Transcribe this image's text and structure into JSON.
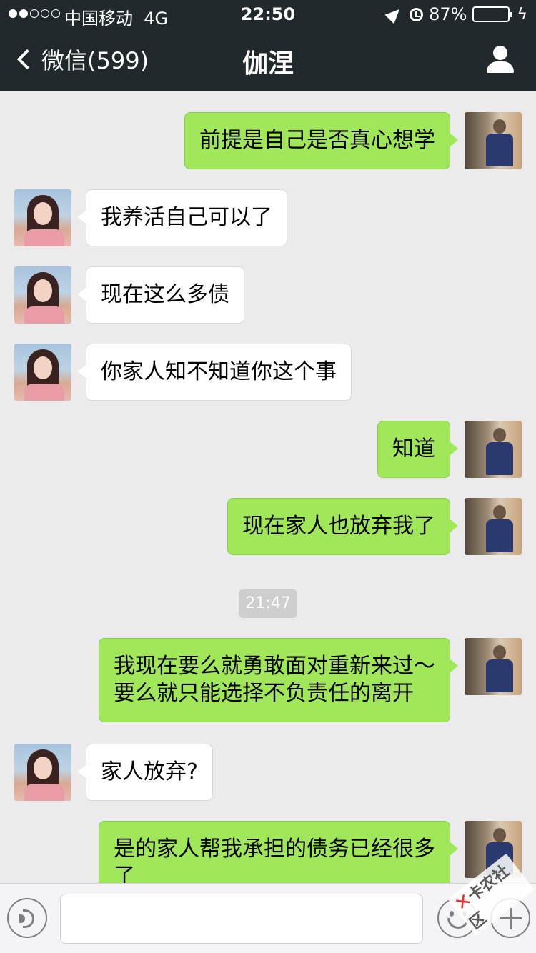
{
  "status_bar": {
    "carrier": "中国移动",
    "network": "4G",
    "time": "22:50",
    "battery_percent": "87%",
    "battery_level": 0.87,
    "signal_bars_filled": 2,
    "signal_bars_total": 5
  },
  "nav": {
    "back_label": "微信(599)",
    "title": "伽涅"
  },
  "messages": [
    {
      "side": "out",
      "text": "前提是自己是否真心想学"
    },
    {
      "side": "in",
      "text": "我养活自己可以了"
    },
    {
      "side": "in",
      "text": "现在这么多债"
    },
    {
      "side": "in",
      "text": "你家人知不知道你这个事"
    },
    {
      "side": "out",
      "text": "知道"
    },
    {
      "side": "out",
      "text": "现在家人也放弃我了"
    },
    {
      "timestamp": "21:47"
    },
    {
      "side": "out",
      "lines": [
        "我现在要么就勇敢面对重新来过～",
        "要么就只能选择不负责任的离开"
      ]
    },
    {
      "side": "in",
      "text": "家人放弃?"
    },
    {
      "side": "out",
      "lines": [
        "是的家人帮我承担的债务已经很多",
        "了"
      ]
    }
  ],
  "watermark": "卡农社区",
  "colors": {
    "nav_bg": "#22292c",
    "chat_bg": "#ebebeb",
    "outgoing_bubble": "#a0e75a",
    "incoming_bubble": "#ffffff",
    "battery_fill": "#4cd964"
  }
}
